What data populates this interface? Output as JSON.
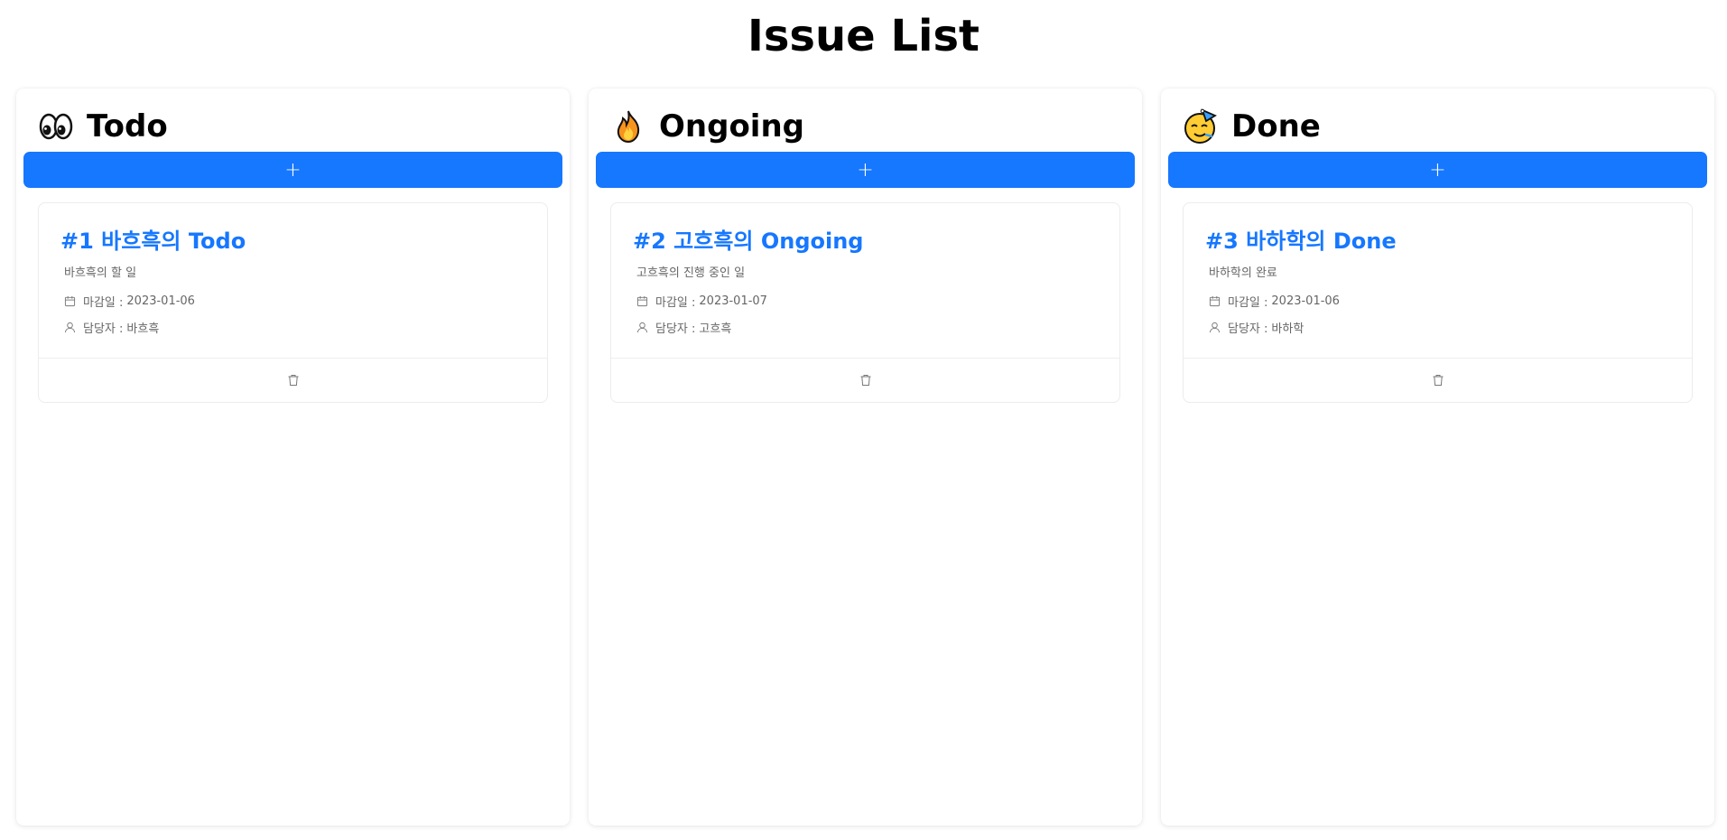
{
  "page": {
    "title": "Issue List"
  },
  "columns": [
    {
      "title": "Todo",
      "icon": "eyes-icon",
      "add_label": "+",
      "issue": {
        "title": "#1 바흐흑의 Todo",
        "description": "바흐흑의 할 일",
        "deadline_label": "마감일 :",
        "deadline": "2023-01-06",
        "assignee_label": "담당자 :",
        "assignee": "바흐흑"
      }
    },
    {
      "title": "Ongoing",
      "icon": "fire-icon",
      "add_label": "+",
      "issue": {
        "title": "#2 고흐흑의 Ongoing",
        "description": "고흐흑의 진행 중인 일",
        "deadline_label": "마감일 :",
        "deadline": "2023-01-07",
        "assignee_label": "담당자 :",
        "assignee": "고흐흑"
      }
    },
    {
      "title": "Done",
      "icon": "party-face-icon",
      "add_label": "+",
      "issue": {
        "title": "#3 바하학의 Done",
        "description": "바하학의 완료",
        "deadline_label": "마감일 :",
        "deadline": "2023-01-06",
        "assignee_label": "담당자 :",
        "assignee": "바하학"
      }
    }
  ],
  "colors": {
    "accent": "#1677ff",
    "muted_text": "#666666"
  }
}
